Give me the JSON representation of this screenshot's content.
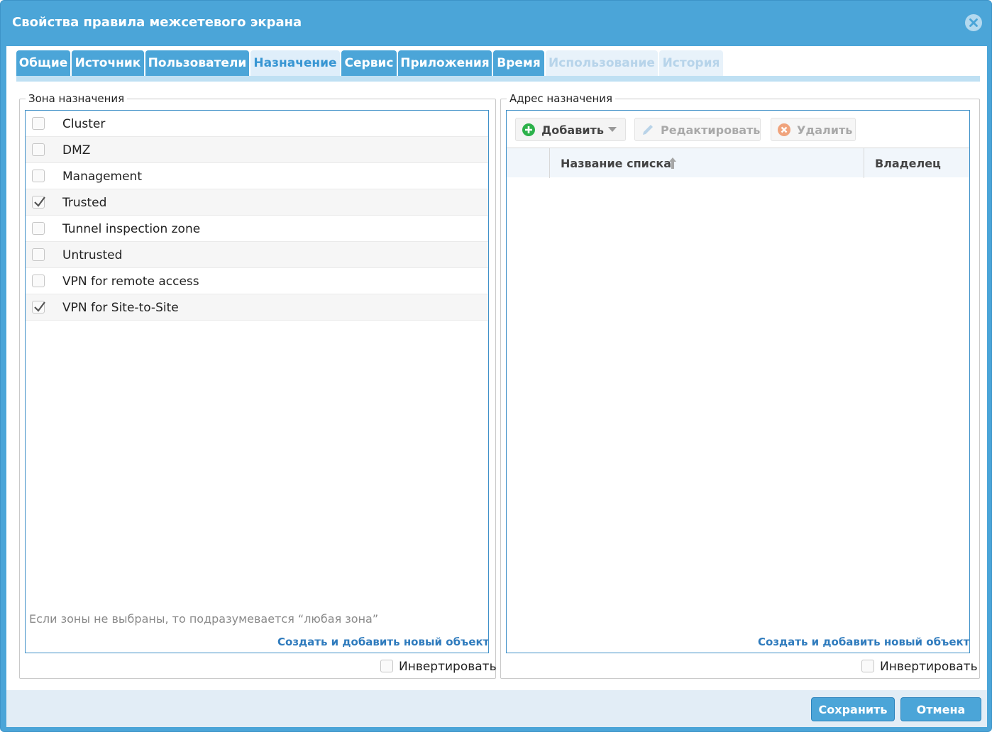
{
  "window": {
    "title": "Свойства правила межсетевого экрана",
    "close_icon": "close-circle-icon"
  },
  "tabs": [
    {
      "label": "Общие",
      "state": "normal"
    },
    {
      "label": "Источник",
      "state": "normal"
    },
    {
      "label": "Пользователи",
      "state": "normal"
    },
    {
      "label": "Назначение",
      "state": "active"
    },
    {
      "label": "Сервис",
      "state": "normal"
    },
    {
      "label": "Приложения",
      "state": "normal"
    },
    {
      "label": "Время",
      "state": "normal"
    },
    {
      "label": "Использование",
      "state": "disabled"
    },
    {
      "label": "История",
      "state": "disabled"
    }
  ],
  "zone_panel": {
    "legend": "Зона назначения",
    "zones": [
      {
        "label": "Cluster",
        "checked": false
      },
      {
        "label": "DMZ",
        "checked": false
      },
      {
        "label": "Management",
        "checked": false
      },
      {
        "label": "Trusted",
        "checked": true
      },
      {
        "label": "Tunnel inspection zone",
        "checked": false
      },
      {
        "label": "Untrusted",
        "checked": false
      },
      {
        "label": "VPN for remote access",
        "checked": false
      },
      {
        "label": "VPN for Site-to-Site",
        "checked": true
      }
    ],
    "hint": "Если зоны не выбраны, то подразумевается “любая зона”",
    "create_link": "Создать и добавить новый объект",
    "invert_label": "Инвертировать",
    "invert_checked": false
  },
  "address_panel": {
    "legend": "Адрес назначения",
    "toolbar": {
      "add_label": "Добавить",
      "add_icon": "plus-circle-icon",
      "edit_label": "Редактировать",
      "edit_icon": "pencil-icon",
      "delete_label": "Удалить",
      "delete_icon": "x-circle-icon"
    },
    "columns": {
      "name": "Название списка",
      "sort_icon": "sort-ascending-arrow-icon",
      "owner": "Владелец"
    },
    "rows": [],
    "create_link": "Создать и добавить новый объект",
    "invert_label": "Инвертировать",
    "invert_checked": false
  },
  "footer": {
    "save_label": "Сохранить",
    "cancel_label": "Отмена"
  },
  "colors": {
    "header_blue": "#4ba5d8",
    "active_tab_bg": "#dfeefa",
    "active_tab_text": "#3896d3",
    "link_blue": "#2f7bbd",
    "add_green": "#2cb14a",
    "delete_orange": "#f0a37c"
  }
}
